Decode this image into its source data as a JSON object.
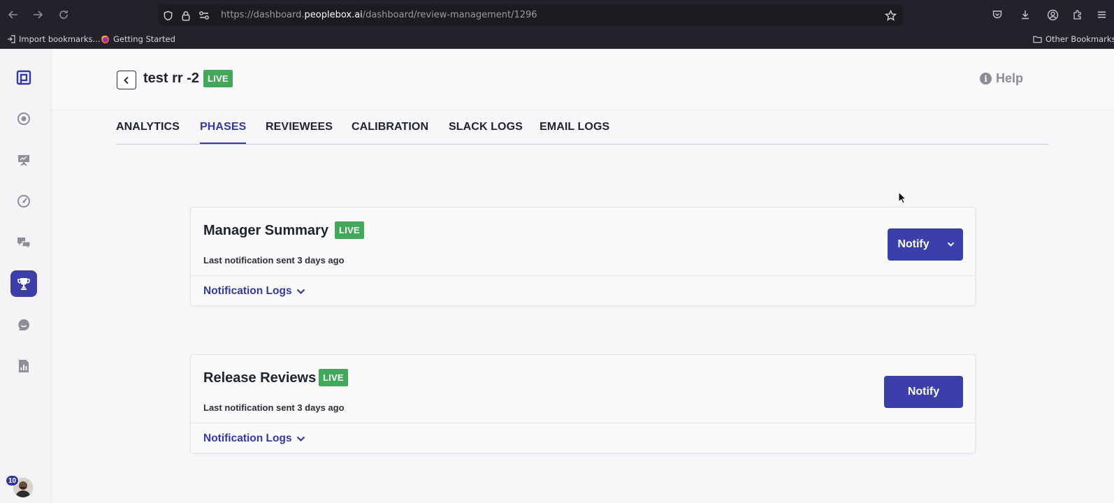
{
  "browser": {
    "url_prefix": "https://dashboard.",
    "url_host": "peoplebox.ai",
    "url_path": "/dashboard/review-management/1296",
    "bookmarks": [
      {
        "label": "Import bookmarks..."
      },
      {
        "label": "Getting Started"
      }
    ],
    "other_bookmarks": "Other Bookmarks"
  },
  "header": {
    "title": "test rr -2",
    "status": "LIVE",
    "help_label": "Help"
  },
  "tabs": [
    {
      "label": "ANALYTICS"
    },
    {
      "label": "PHASES"
    },
    {
      "label": "REVIEWEES"
    },
    {
      "label": "CALIBRATION"
    },
    {
      "label": "SLACK LOGS"
    },
    {
      "label": "EMAIL LOGS"
    }
  ],
  "active_tab": "PHASES",
  "phases": [
    {
      "title": "Manager Summary",
      "status": "LIVE",
      "last_notification": "Last notification sent 3 days ago",
      "logs_label": "Notification Logs",
      "notify_label": "Notify"
    },
    {
      "title": "Release Reviews",
      "status": "LIVE",
      "last_notification": "Last notification sent 3 days ago",
      "logs_label": "Notification Logs",
      "notify_label": "Notify"
    }
  ],
  "user": {
    "notification_count": "10"
  },
  "colors": {
    "accent": "#3a3fa9",
    "live": "#43a95a"
  }
}
